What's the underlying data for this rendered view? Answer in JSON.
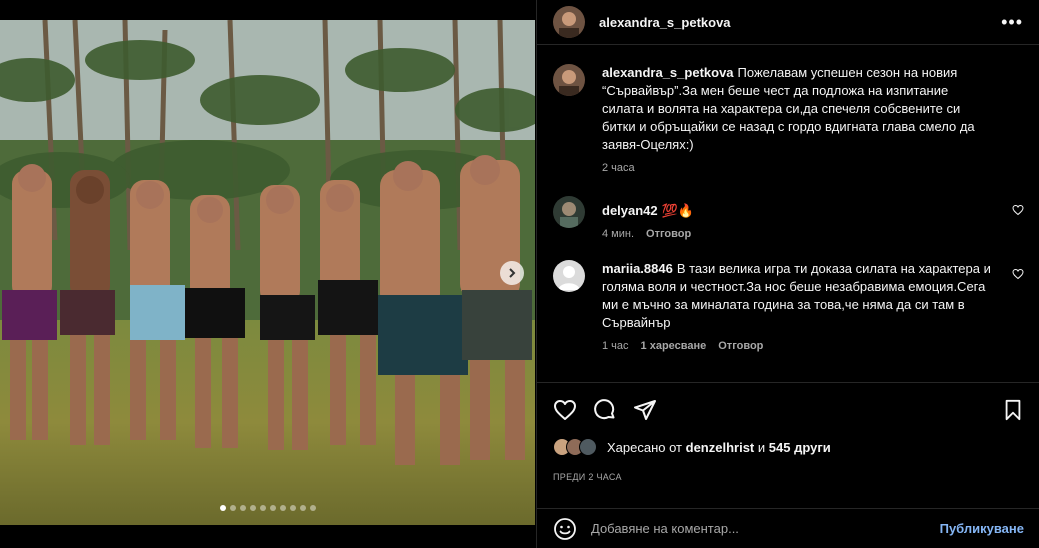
{
  "post": {
    "username": "alexandra_s_petkova",
    "caption": "Пожелавам успешен сезон на новия “Сървайвър”.За мен беше чест да подложа на изпитание силата и волята на характера си,да спечеля собсвените си битки и обръщайки се назад с гордо вдигната глава смело да заявя-Оцелях:)",
    "caption_time": "2 часа",
    "more_icon": "more-horizontal-icon"
  },
  "media": {
    "alt": "",
    "dots_total": 10,
    "dots_active": 0
  },
  "comments": [
    {
      "username": "delyan42",
      "text": "💯🔥",
      "time": "4 мин.",
      "likes": "",
      "reply": "Отговор"
    },
    {
      "username": "mariia.8846",
      "text": "В тази велика игра ти доказа силата на характера и голяма воля и честност.За нос беше незабравима емоция.Сега ми е мъчно за миналата година за това,че няма да си там в Сървайнър",
      "time": "1 час",
      "likes": "1 харесване",
      "reply": "Отговор"
    }
  ],
  "likes": {
    "prefix": "Харесано от",
    "user": "denzelhrist",
    "joiner": "и",
    "others": "545 други"
  },
  "date": "ПРЕДИ 2 ЧАСА",
  "add_comment": {
    "placeholder": "Добавяне на коментар...",
    "post_label": "Публикуване"
  },
  "colors": {
    "accent": "#85b6f5",
    "background": "#000000",
    "divider": "#262626",
    "muted": "#a8a8a8"
  }
}
